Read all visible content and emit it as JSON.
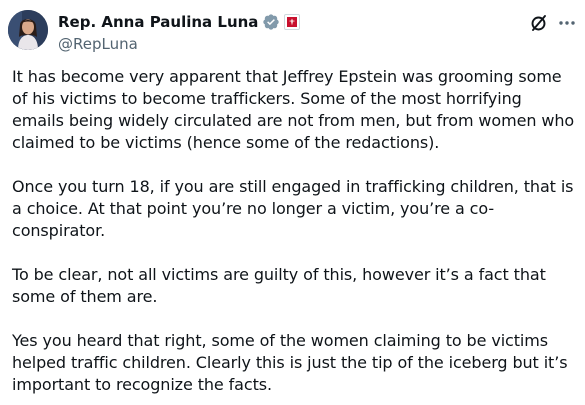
{
  "author": {
    "display_name": "Rep. Anna Paulina Luna",
    "handle": "@RepLuna",
    "verified_badge": "verified-check-icon",
    "affiliation_badge": "congress-affiliation-icon"
  },
  "actions": {
    "grok_icon": "grok-icon",
    "more_icon": "more-options-icon"
  },
  "colors": {
    "text": "#0f1419",
    "secondary": "#536471",
    "verified_badge": "#829aab",
    "affiliation_red": "#c8102e"
  },
  "post": {
    "paragraphs": [
      "It has become very apparent that Jeffrey Epstein was grooming some of his victims to become traffickers. Some of the most horrifying emails being widely circulated are not from men, but from women who claimed to be victims (hence some of the redactions).",
      "Once you turn 18, if you are still engaged in trafficking children, that is a choice. At that point you’re no longer a victim, you’re a co-conspirator.",
      "To be clear, not all victims are guilty of this, however it’s a fact that some of them are.",
      "Yes you heard that right, some of the women claiming to be victims helped traffic children. Clearly this is just the tip of the iceberg but it’s important to recognize the facts."
    ]
  }
}
